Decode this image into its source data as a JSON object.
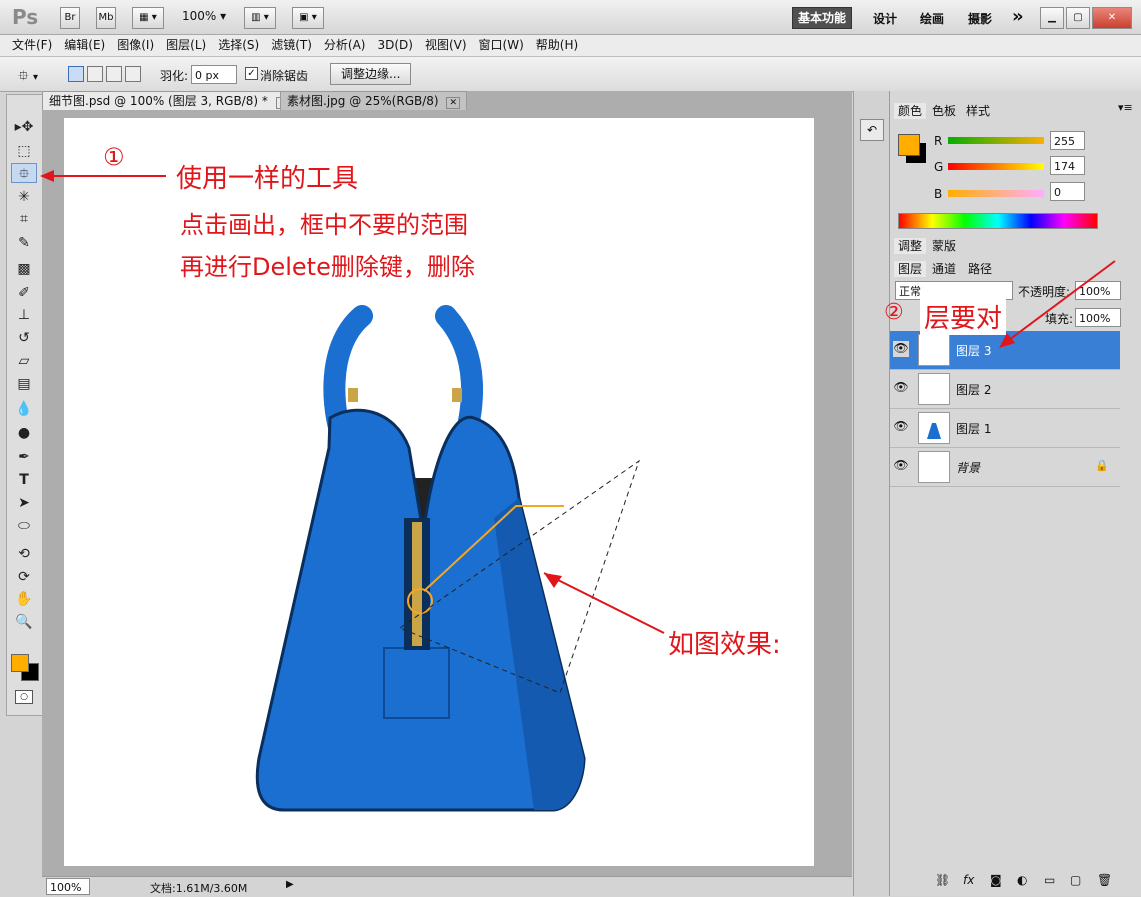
{
  "titlebar": {
    "app_logo": "Ps",
    "br": "Br",
    "mb": "Mb",
    "zoom": "100%",
    "workspaces": [
      "基本功能",
      "设计",
      "绘画",
      "摄影"
    ],
    "more": "»"
  },
  "menu": [
    "文件(F)",
    "编辑(E)",
    "图像(I)",
    "图层(L)",
    "选择(S)",
    "滤镜(T)",
    "分析(A)",
    "3D(D)",
    "视图(V)",
    "窗口(W)",
    "帮助(H)"
  ],
  "options": {
    "feather_label": "羽化:",
    "feather_value": "0 px",
    "antialias_label": "消除锯齿",
    "refine_edge": "调整边缘..."
  },
  "tabs": [
    {
      "label": "细节图.psd @ 100% (图层 3, RGB/8) *"
    },
    {
      "label": "素材图.jpg @ 25%(RGB/8)"
    }
  ],
  "panels": {
    "color_tabs": [
      "颜色",
      "色板",
      "样式"
    ],
    "r_label": "R",
    "g_label": "G",
    "b_label": "B",
    "r_value": "255",
    "g_value": "174",
    "b_value": "0",
    "adj_tabs": [
      "调整",
      "蒙版"
    ],
    "layer_tabs": [
      "图层",
      "通道",
      "路径"
    ],
    "blend_mode": "正常",
    "opacity_label": "不透明度:",
    "opacity_value": "100%",
    "fill_label": "填充:",
    "fill_value": "100%",
    "layers": [
      {
        "name": "图层 3",
        "selected": true
      },
      {
        "name": "图层 2",
        "selected": false
      },
      {
        "name": "图层 1",
        "selected": false
      },
      {
        "name": "背景",
        "selected": false
      }
    ]
  },
  "status": {
    "zoom": "100%",
    "doc": "文档:1.61M/3.60M"
  },
  "annotations": {
    "circle1": "①",
    "line1": "使用一样的工具",
    "line2": "点击画出，框中不要的范围",
    "line3": "再进行Delete删除键，删除",
    "circle2_text": "②",
    "layer_note": "层要对",
    "effect": "如图效果:"
  },
  "colors": {
    "foreground": "#ffae00",
    "background": "#000000",
    "annotation": "#e0161a",
    "bag": "#1a6fd1",
    "selected_layer": "#3a7fd6"
  }
}
